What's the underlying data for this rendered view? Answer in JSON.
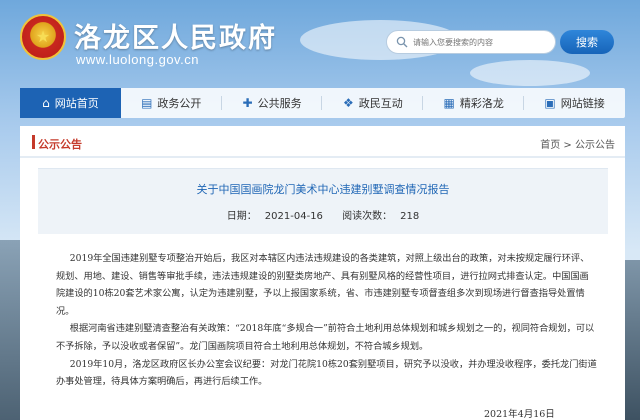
{
  "header": {
    "site_title": "洛龙区人民政府",
    "site_url": "www.luolong.gov.cn",
    "emblem_glyph": "★",
    "search_placeholder": "请输入您要搜索的内容",
    "search_button": "搜索"
  },
  "nav": {
    "items": [
      {
        "label": "网站首页",
        "icon": "home-icon",
        "glyph": "⌂",
        "active": true
      },
      {
        "label": "政务公开",
        "icon": "document-icon",
        "glyph": "▤"
      },
      {
        "label": "公共服务",
        "icon": "service-icon",
        "glyph": "✚"
      },
      {
        "label": "政民互动",
        "icon": "interaction-icon",
        "glyph": "❖"
      },
      {
        "label": "精彩洛龙",
        "icon": "gallery-icon",
        "glyph": "▦"
      },
      {
        "label": "网站链接",
        "icon": "link-icon",
        "glyph": "▣"
      }
    ]
  },
  "section": {
    "title": "公示公告",
    "breadcrumb_prefix": "首页 > ",
    "breadcrumb_current": "公示公告"
  },
  "article": {
    "title": "关于中国国画院龙门美术中心违建别墅调查情况报告",
    "date_label": "日期：",
    "date": "2021-04-16",
    "views_label": "阅读次数：",
    "views": "218",
    "paragraphs": [
      "2019年全国违建别墅专项整治开始后，我区对本辖区内违法违规建设的各类建筑，对照上级出台的政策，对未按规定履行环评、规划、用地、建设、销售等审批手续，违法违规建设的别墅类房地产、具有别墅风格的经营性项目，进行拉网式排查认定。中国国画院建设的10栋20套艺术家公寓，认定为违建别墅，予以上报国家系统，省、市违建别墅专项督查组多次到现场进行督查指导处置情况。",
      "根据河南省违建别墅清查整治有关政策：“2018年底“多规合一”前符合土地利用总体规划和城乡规划之一的，视同符合规划，可以不予拆除，予以没收或者保留”。龙门国画院项目符合土地利用总体规划，不符合城乡规划。",
      "2019年10月，洛龙区政府区长办公室会议纪要：对龙门花院10栋20套别墅项目，研究予以没收，并办理没收程序，委托龙门街道办事处管理，待具体方案明确后，再进行后续工作。"
    ],
    "sign_date": "2021年4月16日"
  },
  "colors": {
    "brand_blue": "#1d63b4",
    "accent_red": "#c53a2b",
    "link_blue": "#1f66b5"
  }
}
